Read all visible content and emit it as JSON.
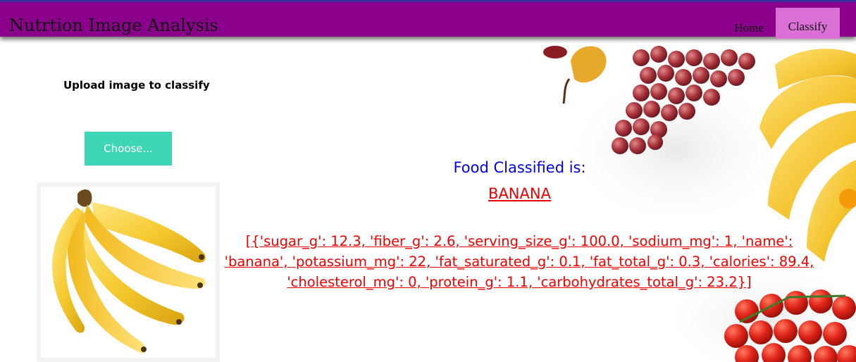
{
  "navbar": {
    "brand": "Nutrtion Image Analysis",
    "items": [
      {
        "label": "Home",
        "active": false
      },
      {
        "label": "Classify",
        "active": true
      }
    ],
    "bg_color": "#8b008b",
    "active_color": "#da70d6"
  },
  "upload": {
    "label": "Upload image to classify",
    "button_label": "Choose...",
    "button_color": "#3fd6b8"
  },
  "preview": {
    "subject": "banana-bunch-image"
  },
  "result": {
    "title": "Food Classified is:",
    "food_name": "BANANA",
    "nutrition_text": "[{'sugar_g': 12.3, 'fiber_g': 2.6, 'serving_size_g': 100.0, 'sodium_mg': 1, 'name': 'banana', 'potassium_mg': 22, 'fat_saturated_g': 0.1, 'fat_total_g': 0.3, 'calories': 89.4, 'cholesterol_mg': 0, 'protein_g': 1.1, 'carbohydrates_total_g': 23.2}]",
    "title_color": "#0000ee",
    "value_color": "#ee0000"
  }
}
